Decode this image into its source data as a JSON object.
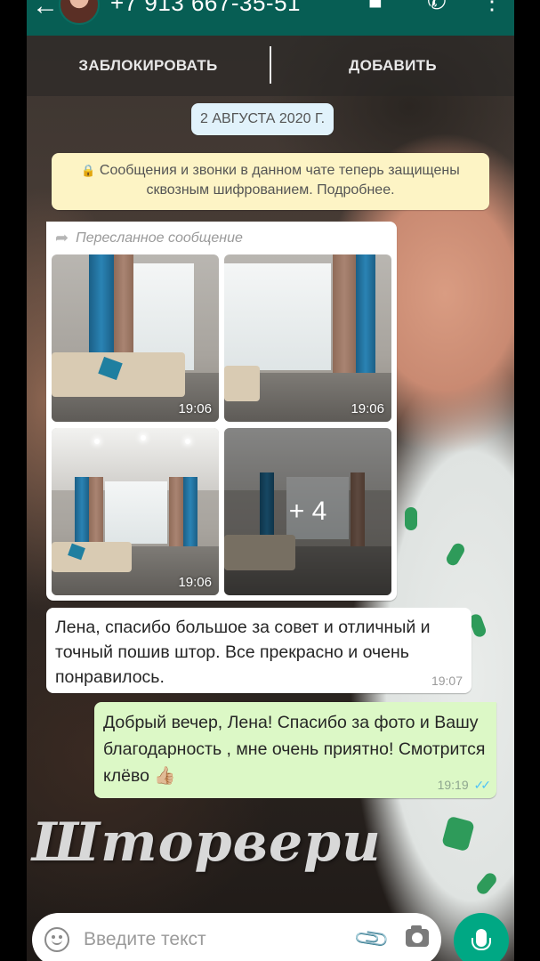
{
  "header": {
    "phone_number": "+7 913 667-35-51",
    "icons": [
      "back-arrow-icon",
      "video-call-icon",
      "voice-call-icon",
      "more-vert-icon"
    ]
  },
  "actions": {
    "block_label": "ЗАБЛОКИРОВАТЬ",
    "add_label": "ДОБАВИТЬ"
  },
  "chat": {
    "date": "2 АВГУСТА 2020 Г.",
    "encryption_notice": "Сообщения и звонки в данном чате теперь защищены сквозным шифрованием. Подробнее.",
    "album": {
      "forwarded_label": "Пересланное сообщение",
      "photos": [
        {
          "time": "19:06"
        },
        {
          "time": "19:06"
        },
        {
          "time": "19:06"
        },
        {
          "more": "+ 4"
        }
      ]
    },
    "incoming": {
      "text": "Лена, спасибо большое за совет и отличный и точный пошив штор. Все прекрасно и очень понравилось.",
      "time": "19:07"
    },
    "outgoing": {
      "text": "Добрый вечер, Лена! Спасибо за фото и Вашу благодарность , мне очень приятно! Смотрится клёво",
      "emoji": "👍🏼",
      "time": "19:19",
      "status": "read"
    }
  },
  "watermark": "Шторвери",
  "composer": {
    "placeholder": "Введите текст",
    "icons": [
      "emoji-icon",
      "attach-icon",
      "camera-icon",
      "mic-icon"
    ]
  },
  "colors": {
    "header": "#075e54",
    "outgoing_bubble": "#dcf8c6",
    "incoming_bubble": "#ffffff",
    "date_pill": "#e1f2fb",
    "notice": "#fdf4c5",
    "mic_button": "#00a884",
    "read_ticks": "#4fc3f7"
  }
}
